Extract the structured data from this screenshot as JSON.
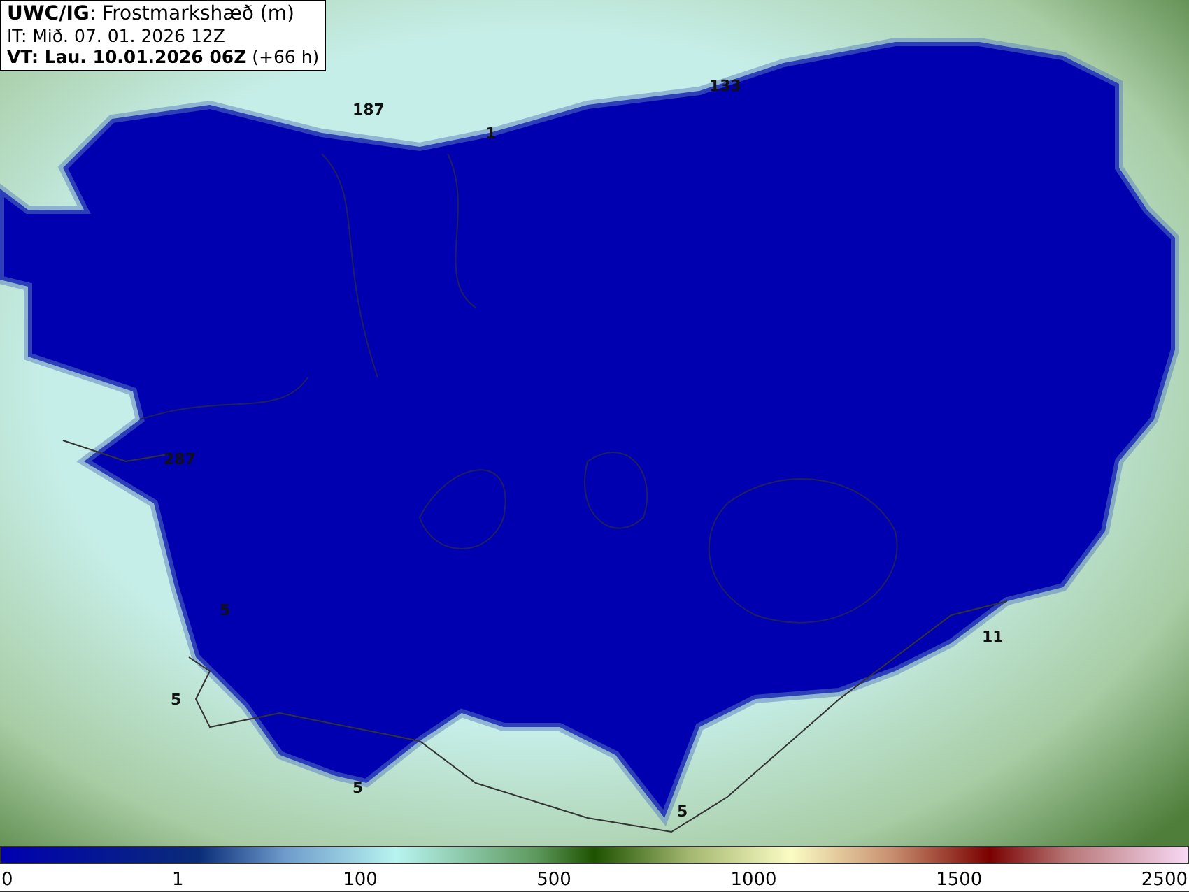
{
  "header": {
    "title": "**UWC/IG**: Frostmarkshæð (m)",
    "initial_time": "IT: Mið. 07. 01. 2026 12Z",
    "valid_time": "**VT: Lau. 10.01.2026 06Z** (+66 h)"
  },
  "map": {
    "labels": [
      {
        "text": "187"
      },
      {
        "text": "133"
      },
      {
        "text": "1"
      },
      {
        "text": "287"
      },
      {
        "text": "5"
      },
      {
        "text": "5"
      },
      {
        "text": "5"
      },
      {
        "text": "11"
      },
      {
        "text": "5"
      }
    ]
  },
  "colorbar": {
    "ticks": [
      "0",
      "1",
      "100",
      "500",
      "1000",
      "1500",
      "2500"
    ]
  }
}
